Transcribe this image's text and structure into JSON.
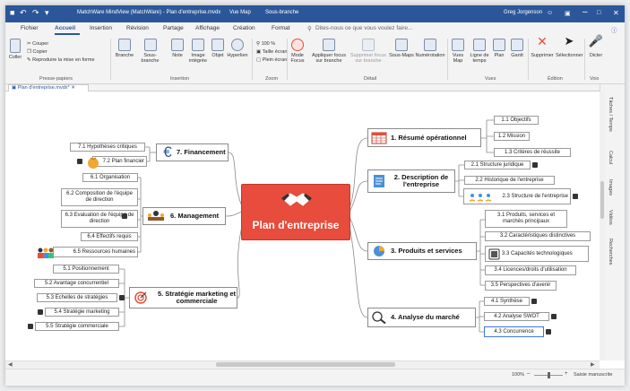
{
  "window": {
    "title": "MatchWare MindView (MatchWare) - Plan d'entreprise.mvdx",
    "context_tabs": [
      "Vue Map",
      "Sous-branche"
    ],
    "user": "Greg Jorgenson"
  },
  "menu": {
    "tabs": [
      "Fichier",
      "Accueil",
      "Insertion",
      "Révision",
      "Partage",
      "Affichage",
      "Création",
      "Format"
    ],
    "active": "Accueil",
    "search_placeholder": "Dites-nous ce que vous voulez faire..."
  },
  "ribbon": {
    "clipboard": {
      "paste": "Coller",
      "cut": "Couper",
      "copy": "Copier",
      "format_painter": "Reproduire la mise en forme",
      "group": "Presse-papiers"
    },
    "insertion": {
      "buttons": [
        "Branche",
        "Sous-branche",
        "Note",
        "Image intégrée",
        "Objet",
        "Hyperlien"
      ],
      "group": "Insertion"
    },
    "zoom": {
      "level": "100 %",
      "fit": "Taille écran",
      "full": "Plein écran",
      "group": "Zoom"
    },
    "detail": {
      "buttons": [
        "Mode Focus",
        "Appliquer focus sur branche",
        "Supprimer focus sur branche",
        "Sous-Maps",
        "Numérotation"
      ],
      "group": "Détail"
    },
    "views": {
      "buttons": [
        "Vues Map",
        "Ligne de temps",
        "Plan",
        "Gantt"
      ],
      "group": "Vues"
    },
    "edition": {
      "buttons": [
        "Supprimer",
        "Sélectionner"
      ],
      "group": "Édition"
    },
    "voice": {
      "buttons": [
        "Dicter"
      ],
      "group": "Voix"
    }
  },
  "doc_tab": "Plan d'entreprise.mvdx*",
  "side_panels": [
    "Tâches / Temps",
    "Calcul",
    "Images",
    "Vidéos",
    "Recherches"
  ],
  "map": {
    "central": "Plan d'entreprise",
    "b1": {
      "title": "1. Résumé opérationnel",
      "subs": [
        "1.1 Objectifs",
        "1.2 Mission",
        "1.3 Critères de réussite"
      ]
    },
    "b2": {
      "title": "2. Description de l'entreprise",
      "subs": [
        "2.1 Structure juridique",
        "2.2 Historique de l'entreprise",
        "2.3 Structure de l'entreprise"
      ]
    },
    "b3": {
      "title": "3. Produits et services",
      "subs": [
        "3.1 Produits, services et marchés principaux",
        "3.2 Caractéristiques distinctives",
        "3.3 Capacités technologiques",
        "3.4 Licences/droits d'utilisation",
        "3.5 Perspectives d'avenir"
      ]
    },
    "b4": {
      "title": "4. Analyse du marché",
      "subs": [
        "4.1 Synthèse",
        "4.2 Analyse SWOT",
        "4.3 Concurrence"
      ]
    },
    "b5": {
      "title": "5. Stratégie marketing et commerciale",
      "subs": [
        "5.1 Positionnement",
        "5.2 Avantage concurrentiel",
        "5.3 Echelles de stratégies",
        "5.4 Stratégie marketing",
        "5.5 Stratégie commerciale"
      ]
    },
    "b6": {
      "title": "6. Management",
      "subs": [
        "6.1 Organisation",
        "6.2 Composition de l'équipe de direction",
        "6.3 Evaluation de l'équipe de direction",
        "6.4 Effectifs requis",
        "6.5 Ressources humaines"
      ]
    },
    "b7": {
      "title": "7. Financement",
      "subs": [
        "7.1 Hypothèses critiques",
        "7.2 Plan financier"
      ]
    }
  },
  "status": {
    "zoom": "100%",
    "mode": "Saisie manuscrite"
  }
}
